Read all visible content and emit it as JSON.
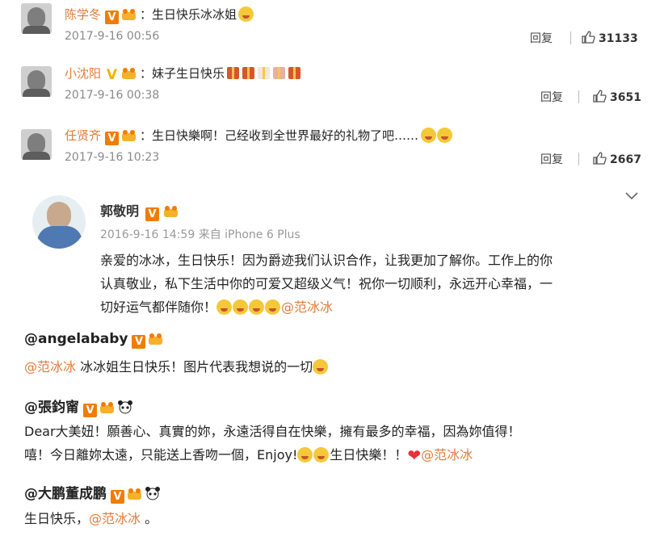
{
  "comments": [
    {
      "user": "陈学冬",
      "text": "：生日快乐冰冰姐",
      "time": "2017-9-16 00:56",
      "reply": "回复",
      "likes": "31133",
      "badge": "orange"
    },
    {
      "user": "小沈阳",
      "text": "：妹子生日快乐",
      "time": "2017-9-16 00:38",
      "reply": "回复",
      "likes": "3651",
      "badge": "gold"
    },
    {
      "user": "任贤齐",
      "text": "：生日快樂啊！己经收到全世界最好的礼物了吧……",
      "time": "2017-9-16 10:23",
      "reply": "回复",
      "likes": "2667",
      "badge": "orange"
    }
  ],
  "post": {
    "author": "郭敬明",
    "meta": "2016-9-16 14:59 来自 iPhone 6 Plus",
    "lines": [
      "亲爱的冰冰，生日快乐！因为爵迹我们认识合作，让我更加了解你。工作上的你",
      "认真敬业，私下生活中你的可爱又超级义气！祝你一切顺利，永远开心幸福，一",
      "切好运气都伴随你！"
    ],
    "mention": "@范冰冰"
  },
  "mentions": [
    {
      "handle": "@angelababy",
      "line1_at": "@范冰冰",
      "line1": " 冰冰姐生日快乐！图片代表我想说的一切"
    },
    {
      "handle": "@張鈞甯",
      "line1": "Dear大美妞！願善心、真實的妳，永遠活得自在快樂，擁有最多的幸福，因為妳值得！",
      "line2": "嘻！今日離妳太遠，只能送上香吻一個，Enjoy!",
      "line2b": "生日快樂！！",
      "line2_at": "@范冰冰"
    },
    {
      "handle": "@大鹏董成鹏",
      "line1": "生日快乐，",
      "line1_at": "@范冰冰",
      "line1_end": " 。"
    }
  ]
}
